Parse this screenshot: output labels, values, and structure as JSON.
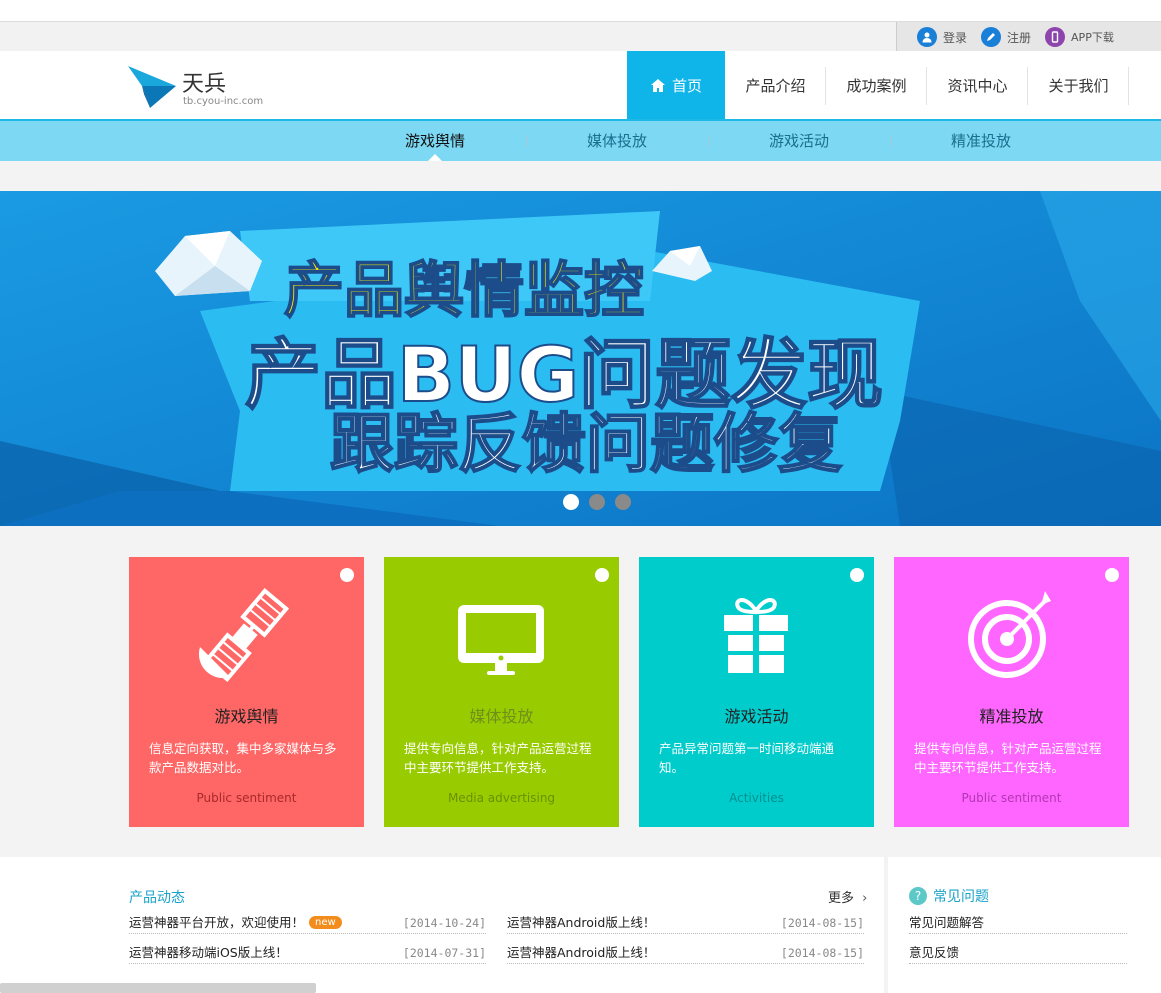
{
  "topbar": {
    "links": [
      {
        "label": "登录",
        "icon": "user-icon",
        "color": "#1a7fd6"
      },
      {
        "label": "注册",
        "icon": "pencil-icon",
        "color": "#1a7fd6"
      },
      {
        "label": "APP下载",
        "icon": "phone-icon",
        "color": "#8e44ad"
      }
    ]
  },
  "logo": {
    "name": "天兵",
    "domain": "tb.cyou-inc.com"
  },
  "nav": {
    "items": [
      "首页",
      "产品介绍",
      "成功案例",
      "资讯中心",
      "关于我们"
    ],
    "active": 0,
    "active_color": "#0fb4e8"
  },
  "subnav": {
    "items": [
      "游戏舆情",
      "媒体投放",
      "游戏活动",
      "精准投放"
    ],
    "active": 0
  },
  "banner": {
    "line1": "产品舆情监控",
    "line2": "产品BUG问题发现",
    "line3": "跟踪反馈问题修复",
    "slides": 3,
    "active_slide": 0
  },
  "cards": [
    {
      "title": "游戏舆情",
      "desc": "信息定向获取，集中多家媒体与多款产品数据对比。",
      "en": "Public sentiment",
      "color": "#ff6666",
      "en_color": "#a82a2a",
      "title_color": "#222",
      "icon": "satellite-icon"
    },
    {
      "title": "媒体投放",
      "desc": "提供专向信息，针对产品运营过程中主要环节提供工作支持。",
      "en": "Media advertising",
      "color": "#99cc00",
      "en_color": "#6b8f00",
      "title_color": "#6f8f1a",
      "icon": "monitor-icon"
    },
    {
      "title": "游戏活动",
      "desc": "产品异常问题第一时间移动端通知。",
      "en": "Activities",
      "color": "#00cccc",
      "en_color": "#008f8f",
      "title_color": "#222",
      "icon": "gift-icon"
    },
    {
      "title": "精准投放",
      "desc": "提供专向信息，针对产品运营过程中主要环节提供工作支持。",
      "en": "Public sentiment",
      "color": "#ff66ff",
      "en_color": "#b236b2",
      "title_color": "#222",
      "icon": "target-icon"
    }
  ],
  "news": {
    "title": "产品动态",
    "more": "更多",
    "items": [
      {
        "text": "运营神器平台开放，欢迎使用！",
        "badge": "new",
        "date": "[2014-10-24]"
      },
      {
        "text": "运营神器Android版上线！",
        "badge": "",
        "date": "[2014-08-15]"
      },
      {
        "text": "运营神器移动端iOS版上线！",
        "badge": "",
        "date": "[2014-07-31]"
      },
      {
        "text": "运营神器Android版上线！",
        "badge": "",
        "date": "[2014-08-15]"
      }
    ]
  },
  "faq": {
    "title": "常见问题",
    "items": [
      "常见问题解答",
      "意见反馈"
    ]
  }
}
